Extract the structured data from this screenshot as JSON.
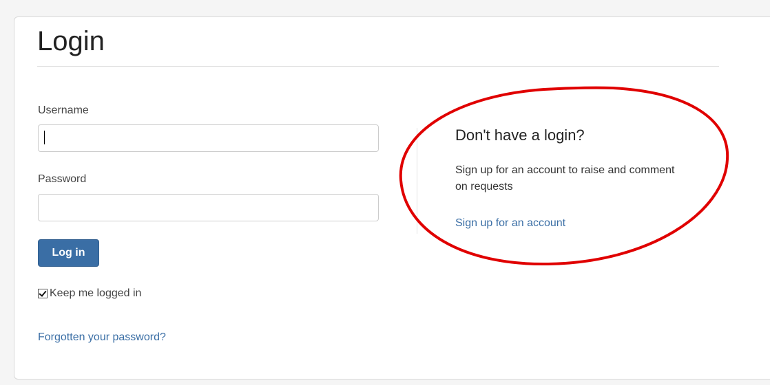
{
  "login": {
    "title": "Login",
    "username_label": "Username",
    "username_value": "",
    "password_label": "Password",
    "password_value": "",
    "submit_label": "Log in",
    "remember_label": "Keep me logged in",
    "remember_checked": true,
    "forgot_link": "Forgotten your password?"
  },
  "signup": {
    "heading": "Don't have a login?",
    "text": "Sign up for an account to raise and comment on requests",
    "link": "Sign up for an account"
  },
  "colors": {
    "primary": "#3a6ea5",
    "link": "#3a6ea5",
    "annotation": "#e00000",
    "border": "#d8d8d8"
  }
}
